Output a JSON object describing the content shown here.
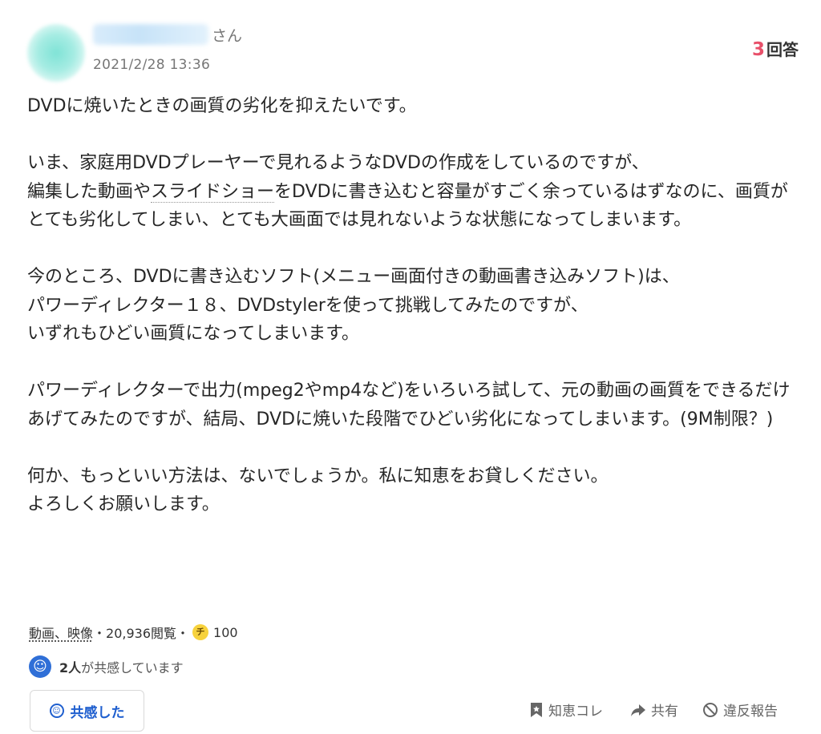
{
  "user": {
    "honorific": "さん",
    "posted_at": "2021/2/28 13:36"
  },
  "answers": {
    "count": "3",
    "label": "回答"
  },
  "question": {
    "title": "DVDに焼いたときの画質の劣化を抑えたいです。",
    "p1_line1": "いま、家庭用DVDプレーヤーで見れるようなDVDの作成をしているのですが、",
    "p1_rest_a": "編集した動画や",
    "p1_rest_ul": "スライドショー",
    "p1_rest_b": "をDVDに書き込むと容量がすごく余っているはずなのに、画質がとても劣化してしまい、とても大画面では見れないような状態になってしまいます。",
    "p2_line1": "今のところ、DVDに書き込むソフト(メニュー画面付きの動画書き込みソフト)は、",
    "p2_line2": "パワーディレクター１８、DVDstylerを使って挑戦してみたのですが、",
    "p2_line3": "いずれもひどい画質になってしまいます。",
    "p3": "パワーディレクターで出力(mpeg2やmp4など)をいろいろ試して、元の動画の画質をできるだけあげてみたのですが、結局、DVDに焼いた段階でひどい劣化になってしまいます。(9M制限？)",
    "p4_line1": "何か、もっといい方法は、ないでしょうか。私に知恵をお貸しください。",
    "p4_line2": "よろしくお願いします。"
  },
  "meta": {
    "category": "動画、映像",
    "views": "・20,936閲覧・",
    "coin_icon_text": "チ",
    "coins": "100"
  },
  "empathy": {
    "count": "2人",
    "suffix": "が共感しています",
    "button_label": "共感した"
  },
  "actions": {
    "bookmark_label": "知恵コレ",
    "share_label": "共有",
    "report_label": "違反報告"
  },
  "colors": {
    "accent_red": "#e8506a",
    "accent_blue": "#1f5fcf",
    "coin_yellow": "#f7d23c"
  }
}
